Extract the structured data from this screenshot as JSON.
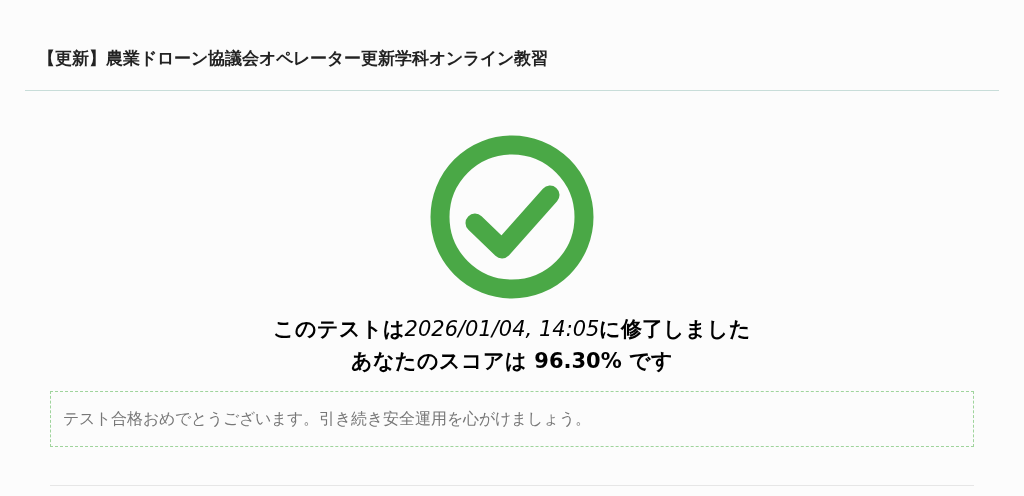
{
  "header": {
    "title": "【更新】農業ドローン協議会オペレーター更新学科オンライン教習"
  },
  "result": {
    "passed": true,
    "completed": {
      "before": "このテストは",
      "time": "2026/01/04, 14:05",
      "after": "に修了しました"
    },
    "score": "あなたのスコアは 96.30% です"
  },
  "message": {
    "text": "テスト合格おめでとうございます。引き続き安全運用を心がけましょう。"
  }
}
